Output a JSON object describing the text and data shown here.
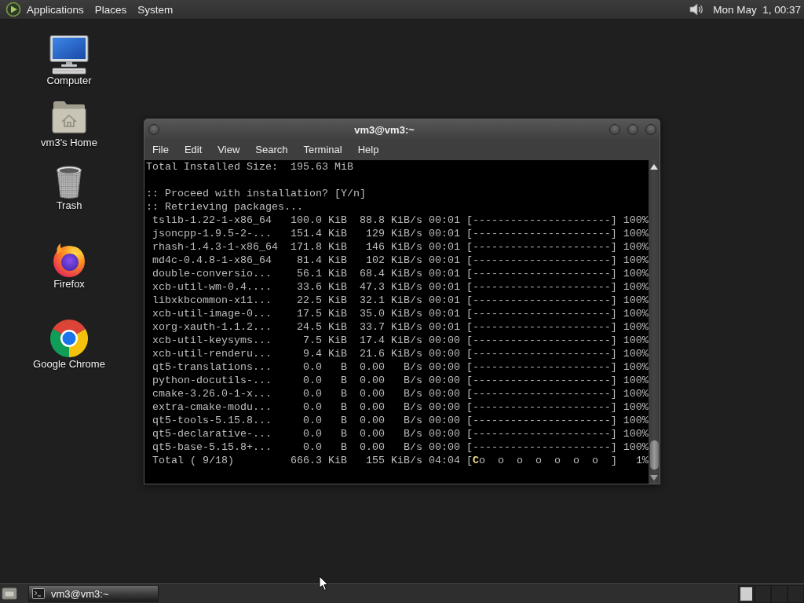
{
  "top_panel": {
    "menus": [
      "Applications",
      "Places",
      "System"
    ],
    "clock": "Mon May  1, 00:37"
  },
  "desktop_icons": [
    {
      "kind": "computer",
      "label": "Computer"
    },
    {
      "kind": "home",
      "label": "vm3's Home"
    },
    {
      "kind": "trash",
      "label": "Trash"
    },
    {
      "kind": "firefox",
      "label": "Firefox"
    },
    {
      "kind": "chrome",
      "label": "Google Chrome"
    }
  ],
  "terminal": {
    "title": "vm3@vm3:~",
    "menu": [
      "File",
      "Edit",
      "View",
      "Search",
      "Terminal",
      "Help"
    ],
    "summary": "Total Installed Size:  195.63 MiB",
    "messages": [
      ":: Proceed with installation? [Y/n]",
      ":: Retrieving packages..."
    ],
    "downloads": [
      "tslib-1.22-1-x86_64   100.0 KiB  88.8 KiB/s 00:01 [----------------------] 100%",
      "jsoncpp-1.9.5-2-...   151.4 KiB   129 KiB/s 00:01 [----------------------] 100%",
      "rhash-1.4.3-1-x86_64  171.8 KiB   146 KiB/s 00:01 [----------------------] 100%",
      "md4c-0.4.8-1-x86_64    81.4 KiB   102 KiB/s 00:01 [----------------------] 100%",
      "double-conversio...    56.1 KiB  68.4 KiB/s 00:01 [----------------------] 100%",
      "xcb-util-wm-0.4....    33.6 KiB  47.3 KiB/s 00:01 [----------------------] 100%",
      "libxkbcommon-x11...    22.5 KiB  32.1 KiB/s 00:01 [----------------------] 100%",
      "xcb-util-image-0...    17.5 KiB  35.0 KiB/s 00:01 [----------------------] 100%",
      "xorg-xauth-1.1.2...    24.5 KiB  33.7 KiB/s 00:01 [----------------------] 100%",
      "xcb-util-keysyms...     7.5 KiB  17.4 KiB/s 00:00 [----------------------] 100%",
      "xcb-util-renderu...     9.4 KiB  21.6 KiB/s 00:00 [----------------------] 100%",
      "qt5-translations...     0.0   B  0.00   B/s 00:00 [----------------------] 100%",
      "python-docutils-...     0.0   B  0.00   B/s 00:00 [----------------------] 100%",
      "cmake-3.26.0-1-x...     0.0   B  0.00   B/s 00:00 [----------------------] 100%",
      "extra-cmake-modu...     0.0   B  0.00   B/s 00:00 [----------------------] 100%",
      "qt5-tools-5.15.8...     0.0   B  0.00   B/s 00:00 [----------------------] 100%",
      "qt5-declarative-...     0.0   B  0.00   B/s 00:00 [----------------------] 100%",
      "qt5-base-5.15.8+...     0.0   B  0.00   B/s 00:00 [----------------------] 100%"
    ],
    "total": "Total ( 9/18)         666.3 KiB   155 KiB/s 04:04 [**C**o  o  o  o  o  o  o  ]   1%"
  },
  "taskbar": {
    "tasks": [
      {
        "label": "vm3@vm3:~",
        "selected": true
      }
    ],
    "workspaces": [
      {
        "selected": true
      },
      {
        "selected": false
      },
      {
        "selected": false
      },
      {
        "selected": false
      }
    ]
  }
}
